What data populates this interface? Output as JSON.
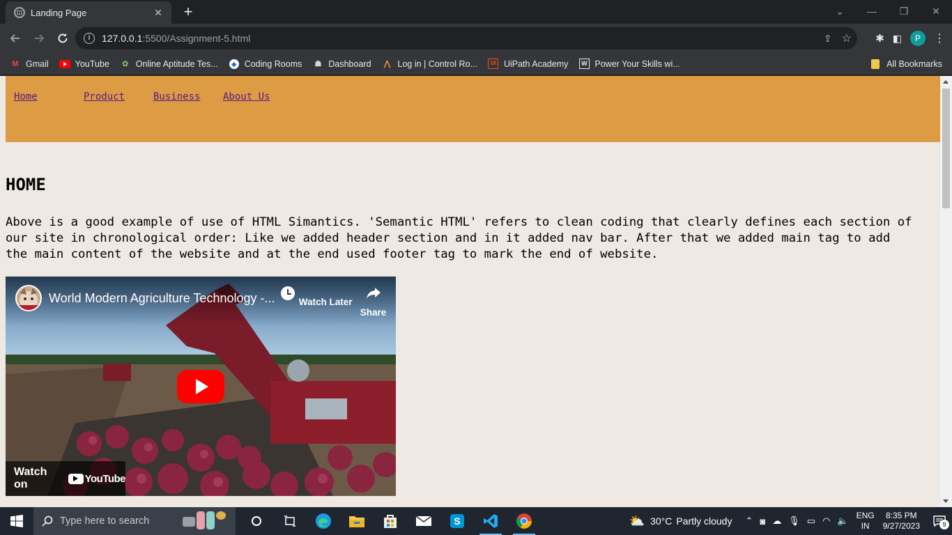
{
  "browser": {
    "tab_title": "Landing Page",
    "url_host": "127.0.0.1",
    "url_path": ":5500/Assignment-5.html",
    "bookmarks": [
      {
        "label": "Gmail",
        "icon": "gmail-icon"
      },
      {
        "label": "YouTube",
        "icon": "youtube-icon"
      },
      {
        "label": "Online Aptitude Tes...",
        "icon": "aptitude-icon"
      },
      {
        "label": "Coding Rooms",
        "icon": "coding-rooms-icon"
      },
      {
        "label": "Dashboard",
        "icon": "dashboard-icon"
      },
      {
        "label": "Log in | Control Ro...",
        "icon": "control-room-icon"
      },
      {
        "label": "UiPath Academy",
        "icon": "uipath-icon"
      },
      {
        "label": "Power Your Skills wi...",
        "icon": "power-skills-icon"
      }
    ],
    "all_bookmarks": "All Bookmarks",
    "profile_initial": "P"
  },
  "page": {
    "nav": [
      "Home",
      "Product",
      "Business",
      "About Us"
    ],
    "heading": "HOME",
    "paragraph": "Above is a good example of use of HTML Simantics. 'Semantic HTML' refers to clean coding that clearly defines each section of our site in chronological order: Like we added header section and in it added nav bar. After that we added main tag to add the main content of the website and at the end used footer tag to mark the end of website.",
    "video": {
      "title": "World Modern Agriculture Technology -...",
      "watch_later": "Watch Later",
      "share": "Share",
      "watch_on": "Watch on",
      "youtube": "YouTube"
    }
  },
  "taskbar": {
    "search_placeholder": "Type here to search",
    "weather_temp": "30°C",
    "weather_desc": "Partly cloudy",
    "lang_1": "ENG",
    "lang_2": "IN",
    "time": "8:35 PM",
    "date": "9/27/2023",
    "notification_count": "9"
  },
  "colors": {
    "header_bg": "#dd9b43",
    "page_bg": "#efe9e3",
    "link": "#551a8b"
  }
}
